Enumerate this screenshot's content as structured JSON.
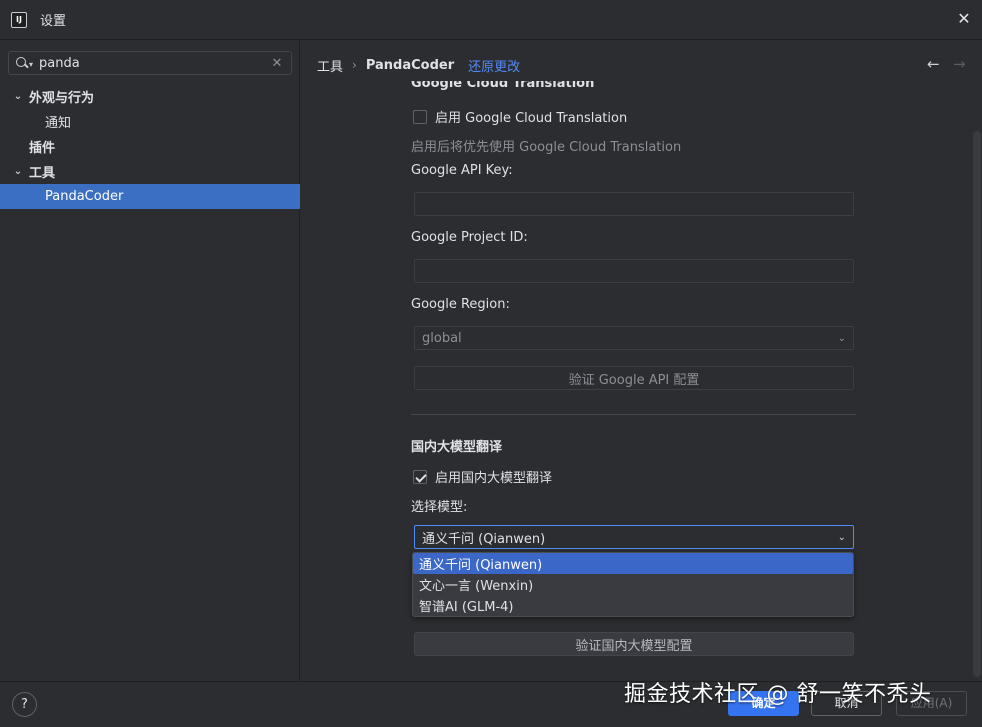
{
  "window": {
    "app_icon_text": "IJ",
    "title": "设置",
    "close_glyph": "✕"
  },
  "sidebar": {
    "search": {
      "value": "panda",
      "clear_glyph": "✕"
    },
    "tree": [
      {
        "label": "外观与行为",
        "chevron": "⌄",
        "bold": true
      },
      {
        "label": "通知",
        "indent": true
      },
      {
        "label": "插件",
        "bold": true
      },
      {
        "label": "工具",
        "chevron": "⌄",
        "bold": true
      },
      {
        "label": "PandaCoder",
        "indent": true,
        "selected": true
      }
    ]
  },
  "breadcrumb": {
    "parent": "工具",
    "separator": "›",
    "current": "PandaCoder",
    "reset": "还原更改"
  },
  "nav": {
    "back": "←",
    "forward": "→"
  },
  "google": {
    "section_title_clipped": "Google Cloud Translation",
    "enable_label": "启用 Google Cloud Translation",
    "enable_checked": false,
    "hint": "启用后将优先使用 Google Cloud Translation",
    "api_key_label": "Google API Key:",
    "api_key_value": "",
    "project_id_label": "Google Project ID:",
    "project_id_value": "",
    "region_label": "Google Region:",
    "region_value": "global",
    "verify_button": "验证 Google API 配置"
  },
  "domestic": {
    "section_title": "国内大模型翻译",
    "enable_label": "启用国内大模型翻译",
    "enable_checked": true,
    "model_label": "选择模型:",
    "model_selected": "通义千问 (Qianwen)",
    "model_options": [
      "通义千问 (Qianwen)",
      "文心一言 (Wenxin)",
      "智谱AI (GLM-4)"
    ],
    "verify_button": "验证国内大模型配置"
  },
  "footer": {
    "help": "?",
    "ok": "确定",
    "cancel": "取消",
    "apply": "应用(A)"
  },
  "watermark": "掘金技术社区 @ 舒一笑不秃头",
  "colors": {
    "accent": "#3574f0",
    "selection": "#3b6fc3",
    "link": "#548af7"
  }
}
